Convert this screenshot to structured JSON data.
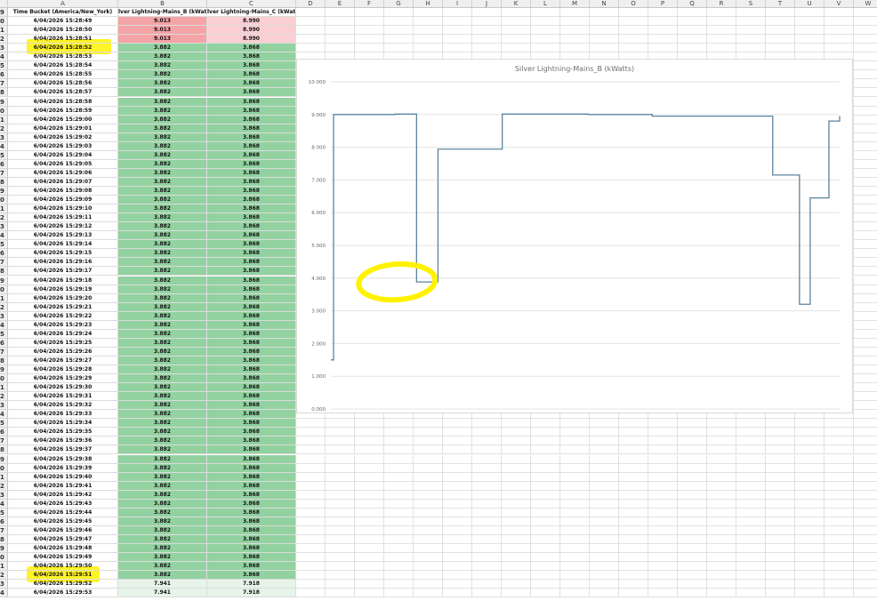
{
  "columns": [
    "A",
    "B",
    "C",
    "D",
    "E",
    "F",
    "G",
    "H",
    "I",
    "J",
    "K",
    "L",
    "M",
    "N",
    "O",
    "P",
    "Q",
    "R",
    "S",
    "T",
    "U",
    "V",
    "W"
  ],
  "header_row": {
    "row_label": "9",
    "a": "Time Bucket (America/New_York)",
    "b": "lver Lightning-Mains_B (kWat",
    "c": "lver Lightning-Mains_C (kWatts)"
  },
  "rows": [
    {
      "rh": "0",
      "a": "6/04/2026 15:28:49",
      "b": "9.013",
      "c": "8.990",
      "style": "red"
    },
    {
      "rh": "1",
      "a": "6/04/2026 15:28:50",
      "b": "9.013",
      "c": "8.990",
      "style": "red"
    },
    {
      "rh": "2",
      "a": "6/04/2026 15:28:51",
      "b": "9.013",
      "c": "8.990",
      "style": "red"
    },
    {
      "rh": "3",
      "a": "6/04/2026 15:28:52",
      "b": "3.882",
      "c": "3.868",
      "style": "green"
    },
    {
      "rh": "4",
      "a": "6/04/2026 15:28:53",
      "b": "3.882",
      "c": "3.868",
      "style": "green"
    },
    {
      "rh": "5",
      "a": "6/04/2026 15:28:54",
      "b": "3.882",
      "c": "3.868",
      "style": "green"
    },
    {
      "rh": "6",
      "a": "6/04/2026 15:28:55",
      "b": "3.882",
      "c": "3.868",
      "style": "green"
    },
    {
      "rh": "7",
      "a": "6/04/2026 15:28:56",
      "b": "3.882",
      "c": "3.868",
      "style": "green"
    },
    {
      "rh": "8",
      "a": "6/04/2026 15:28:57",
      "b": "3.882",
      "c": "3.868",
      "style": "green"
    },
    {
      "rh": "9",
      "a": "6/04/2026 15:28:58",
      "b": "3.882",
      "c": "3.868",
      "style": "green"
    },
    {
      "rh": "0",
      "a": "6/04/2026 15:28:59",
      "b": "3.882",
      "c": "3.868",
      "style": "green"
    },
    {
      "rh": "1",
      "a": "6/04/2026 15:29:00",
      "b": "3.882",
      "c": "3.868",
      "style": "green"
    },
    {
      "rh": "2",
      "a": "6/04/2026 15:29:01",
      "b": "3.882",
      "c": "3.868",
      "style": "green"
    },
    {
      "rh": "3",
      "a": "6/04/2026 15:29:02",
      "b": "3.882",
      "c": "3.868",
      "style": "green"
    },
    {
      "rh": "4",
      "a": "6/04/2026 15:29:03",
      "b": "3.882",
      "c": "3.868",
      "style": "green"
    },
    {
      "rh": "5",
      "a": "6/04/2026 15:29:04",
      "b": "3.882",
      "c": "3.868",
      "style": "green"
    },
    {
      "rh": "6",
      "a": "6/04/2026 15:29:05",
      "b": "3.882",
      "c": "3.868",
      "style": "green"
    },
    {
      "rh": "7",
      "a": "6/04/2026 15:29:06",
      "b": "3.882",
      "c": "3.868",
      "style": "green"
    },
    {
      "rh": "8",
      "a": "6/04/2026 15:29:07",
      "b": "3.882",
      "c": "3.868",
      "style": "green"
    },
    {
      "rh": "9",
      "a": "6/04/2026 15:29:08",
      "b": "3.882",
      "c": "3.868",
      "style": "green"
    },
    {
      "rh": "0",
      "a": "6/04/2026 15:29:09",
      "b": "3.882",
      "c": "3.868",
      "style": "green"
    },
    {
      "rh": "1",
      "a": "6/04/2026 15:29:10",
      "b": "3.882",
      "c": "3.868",
      "style": "green"
    },
    {
      "rh": "2",
      "a": "6/04/2026 15:29:11",
      "b": "3.882",
      "c": "3.868",
      "style": "green"
    },
    {
      "rh": "3",
      "a": "6/04/2026 15:29:12",
      "b": "3.882",
      "c": "3.868",
      "style": "green"
    },
    {
      "rh": "4",
      "a": "6/04/2026 15:29:13",
      "b": "3.882",
      "c": "3.868",
      "style": "green"
    },
    {
      "rh": "5",
      "a": "6/04/2026 15:29:14",
      "b": "3.882",
      "c": "3.868",
      "style": "green"
    },
    {
      "rh": "6",
      "a": "6/04/2026 15:29:15",
      "b": "3.882",
      "c": "3.868",
      "style": "green"
    },
    {
      "rh": "7",
      "a": "6/04/2026 15:29:16",
      "b": "3.882",
      "c": "3.868",
      "style": "green"
    },
    {
      "rh": "8",
      "a": "6/04/2026 15:29:17",
      "b": "3.882",
      "c": "3.868",
      "style": "green"
    },
    {
      "rh": "9",
      "a": "6/04/2026 15:29:18",
      "b": "3.882",
      "c": "3.868",
      "style": "green"
    },
    {
      "rh": "0",
      "a": "6/04/2026 15:29:19",
      "b": "3.882",
      "c": "3.868",
      "style": "green"
    },
    {
      "rh": "1",
      "a": "6/04/2026 15:29:20",
      "b": "3.882",
      "c": "3.868",
      "style": "green"
    },
    {
      "rh": "2",
      "a": "6/04/2026 15:29:21",
      "b": "3.882",
      "c": "3.868",
      "style": "green"
    },
    {
      "rh": "3",
      "a": "6/04/2026 15:29:22",
      "b": "3.882",
      "c": "3.868",
      "style": "green"
    },
    {
      "rh": "4",
      "a": "6/04/2026 15:29:23",
      "b": "3.882",
      "c": "3.868",
      "style": "green"
    },
    {
      "rh": "5",
      "a": "6/04/2026 15:29:24",
      "b": "3.882",
      "c": "3.868",
      "style": "green"
    },
    {
      "rh": "6",
      "a": "6/04/2026 15:29:25",
      "b": "3.882",
      "c": "3.868",
      "style": "green"
    },
    {
      "rh": "7",
      "a": "6/04/2026 15:29:26",
      "b": "3.882",
      "c": "3.868",
      "style": "green"
    },
    {
      "rh": "8",
      "a": "6/04/2026 15:29:27",
      "b": "3.882",
      "c": "3.868",
      "style": "green"
    },
    {
      "rh": "9",
      "a": "6/04/2026 15:29:28",
      "b": "3.882",
      "c": "3.868",
      "style": "green"
    },
    {
      "rh": "0",
      "a": "6/04/2026 15:29:29",
      "b": "3.882",
      "c": "3.868",
      "style": "green"
    },
    {
      "rh": "1",
      "a": "6/04/2026 15:29:30",
      "b": "3.882",
      "c": "3.868",
      "style": "green"
    },
    {
      "rh": "2",
      "a": "6/04/2026 15:29:31",
      "b": "3.882",
      "c": "3.868",
      "style": "green"
    },
    {
      "rh": "3",
      "a": "6/04/2026 15:29:32",
      "b": "3.882",
      "c": "3.868",
      "style": "green"
    },
    {
      "rh": "4",
      "a": "6/04/2026 15:29:33",
      "b": "3.882",
      "c": "3.868",
      "style": "green"
    },
    {
      "rh": "5",
      "a": "6/04/2026 15:29:34",
      "b": "3.882",
      "c": "3.868",
      "style": "green"
    },
    {
      "rh": "6",
      "a": "6/04/2026 15:29:35",
      "b": "3.882",
      "c": "3.868",
      "style": "green"
    },
    {
      "rh": "7",
      "a": "6/04/2026 15:29:36",
      "b": "3.882",
      "c": "3.868",
      "style": "green"
    },
    {
      "rh": "8",
      "a": "6/04/2026 15:29:37",
      "b": "3.882",
      "c": "3.868",
      "style": "green"
    },
    {
      "rh": "9",
      "a": "6/04/2026 15:29:38",
      "b": "3.882",
      "c": "3.868",
      "style": "green"
    },
    {
      "rh": "0",
      "a": "6/04/2026 15:29:39",
      "b": "3.882",
      "c": "3.868",
      "style": "green"
    },
    {
      "rh": "1",
      "a": "6/04/2026 15:29:40",
      "b": "3.882",
      "c": "3.868",
      "style": "green"
    },
    {
      "rh": "2",
      "a": "6/04/2026 15:29:41",
      "b": "3.882",
      "c": "3.868",
      "style": "green"
    },
    {
      "rh": "3",
      "a": "6/04/2026 15:29:42",
      "b": "3.882",
      "c": "3.868",
      "style": "green"
    },
    {
      "rh": "4",
      "a": "6/04/2026 15:29:43",
      "b": "3.882",
      "c": "3.868",
      "style": "green"
    },
    {
      "rh": "5",
      "a": "6/04/2026 15:29:44",
      "b": "3.882",
      "c": "3.868",
      "style": "green"
    },
    {
      "rh": "6",
      "a": "6/04/2026 15:29:45",
      "b": "3.882",
      "c": "3.868",
      "style": "green"
    },
    {
      "rh": "7",
      "a": "6/04/2026 15:29:46",
      "b": "3.882",
      "c": "3.868",
      "style": "green"
    },
    {
      "rh": "8",
      "a": "6/04/2026 15:29:47",
      "b": "3.882",
      "c": "3.868",
      "style": "green"
    },
    {
      "rh": "9",
      "a": "6/04/2026 15:29:48",
      "b": "3.882",
      "c": "3.868",
      "style": "green"
    },
    {
      "rh": "0",
      "a": "6/04/2026 15:29:49",
      "b": "3.882",
      "c": "3.868",
      "style": "green"
    },
    {
      "rh": "1",
      "a": "6/04/2026 15:29:50",
      "b": "3.882",
      "c": "3.868",
      "style": "green"
    },
    {
      "rh": "2",
      "a": "6/04/2026 15:29:51",
      "b": "3.882",
      "c": "3.868",
      "style": "green"
    },
    {
      "rh": "3",
      "a": "6/04/2026 15:29:52",
      "b": "7.941",
      "c": "7.918",
      "style": "lightgreen"
    },
    {
      "rh": "4",
      "a": "6/04/2026 15:29:53",
      "b": "7.941",
      "c": "7.918",
      "style": "lightgreen"
    }
  ],
  "colors": {
    "red_b": "#f4a3a6",
    "red_c": "#f9cfd2",
    "green": "#92d2a1",
    "lightgreen": "#e6f4ea",
    "highlight": "#fff200",
    "line": "#5b84a0"
  },
  "highlighted_rows": [
    3,
    62
  ],
  "chart_data": {
    "type": "line",
    "title": "Silver Lightning-Mains_B (kWatts)",
    "ylim": [
      0,
      10
    ],
    "yticks": [
      "0.000",
      "1.000",
      "2.000",
      "3.000",
      "4.000",
      "5.000",
      "6.000",
      "7.000",
      "8.000",
      "9.000",
      "10.000"
    ],
    "grid": true,
    "series": [
      {
        "name": "Silver Lightning-Mains_B (kWatts)",
        "step": true,
        "x": [
          0,
          1,
          24,
          32,
          40,
          64,
          96,
          120,
          150,
          165,
          175,
          179,
          186,
          190
        ],
        "y": [
          1.5,
          9.0,
          9.013,
          3.882,
          7.941,
          9.013,
          9.0,
          8.95,
          8.95,
          7.15,
          3.2,
          6.45,
          8.8,
          8.95
        ]
      }
    ],
    "annotation": "yellow circle around low segment"
  }
}
